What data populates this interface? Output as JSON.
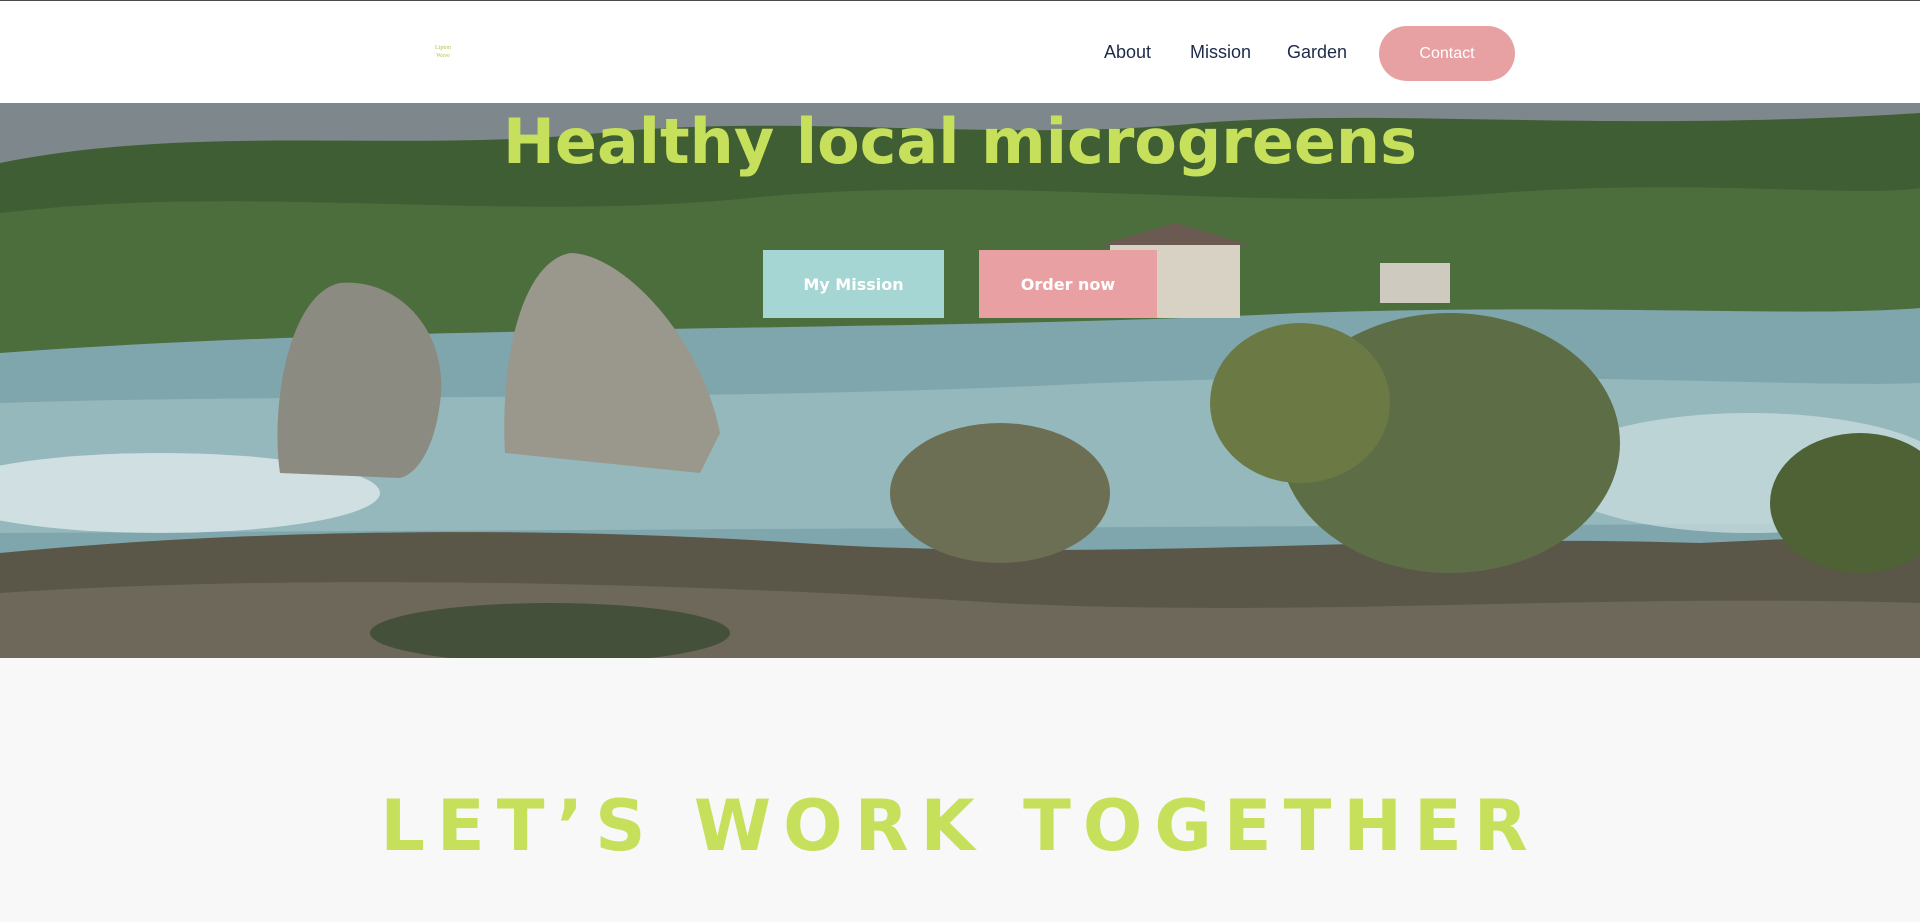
{
  "header": {
    "logo": {
      "line1": "Lipton",
      "line2": "Wave"
    },
    "nav": {
      "about": "About",
      "mission": "Mission",
      "garden": "Garden"
    },
    "contact_label": "Contact"
  },
  "hero": {
    "title": "Healthy local microgreens",
    "primary_button": "My Mission",
    "secondary_button": "Order now",
    "image_description_icon": "waterfall-landscape-image"
  },
  "together": {
    "title": "LET’S WORK TOGETHER"
  },
  "colors": {
    "accent_green": "#c6e05b",
    "button_teal": "#a6d6d3",
    "button_pink": "#e9a0a3",
    "contact_pink": "#e8a1a3",
    "nav_text": "#1d2b4a"
  }
}
